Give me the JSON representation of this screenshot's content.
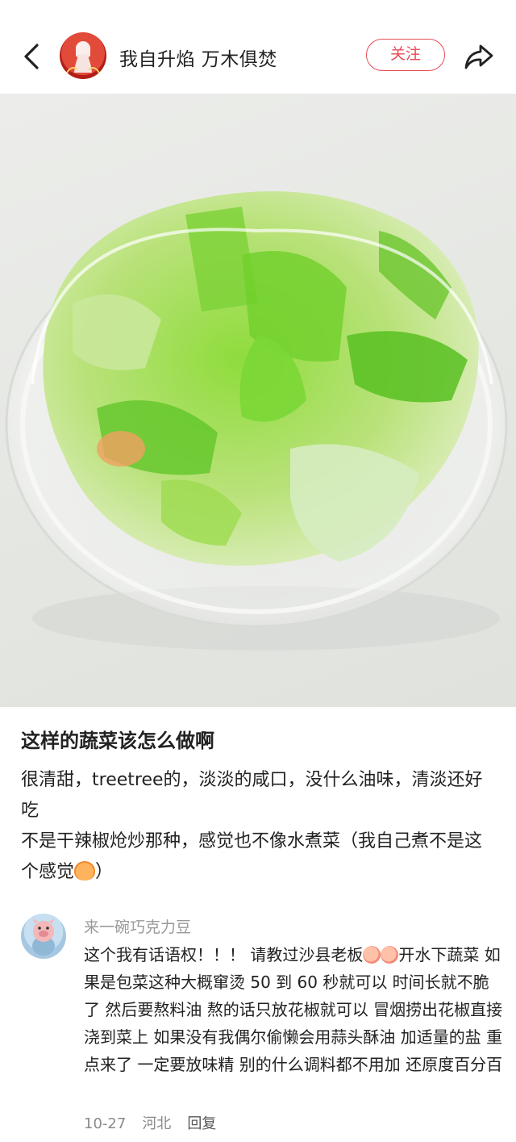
{
  "header": {
    "username": "我自升焰 万木俱焚",
    "follow_label": "关注"
  },
  "post": {
    "title": "这样的蔬菜该怎么做啊",
    "paragraph1": "很清甜，treetree的，淡淡的咸口，没什么油味，清淡还好吃",
    "paragraph2_a": "不是干辣椒炝炒那种，感觉也不像水煮菜（我自己煮不是这个感觉",
    "paragraph2_b": "）"
  },
  "comment": {
    "author": "来一碗巧克力豆",
    "text_a": "这个我有话语权！！！ 请教过沙县老板",
    "text_b": "开水下蔬菜 如果是包菜这种大概窜烫 50 到 60 秒就可以 时间长就不脆了 然后要熬料油 熬的话只放花椒就可以 冒烟捞出花椒直接浇到菜上 如果没有我偶尔偷懒会用蒜头酥油 加适量的盐 重点来了 一定要放味精 别的什么调料都不用加 还原度百分百",
    "date": "10-27",
    "location": "河北",
    "reply_label": "回复"
  },
  "icons": {
    "back": "chevron-left-icon",
    "share": "share-arrow-icon"
  },
  "colors": {
    "accent": "#e84a55"
  }
}
